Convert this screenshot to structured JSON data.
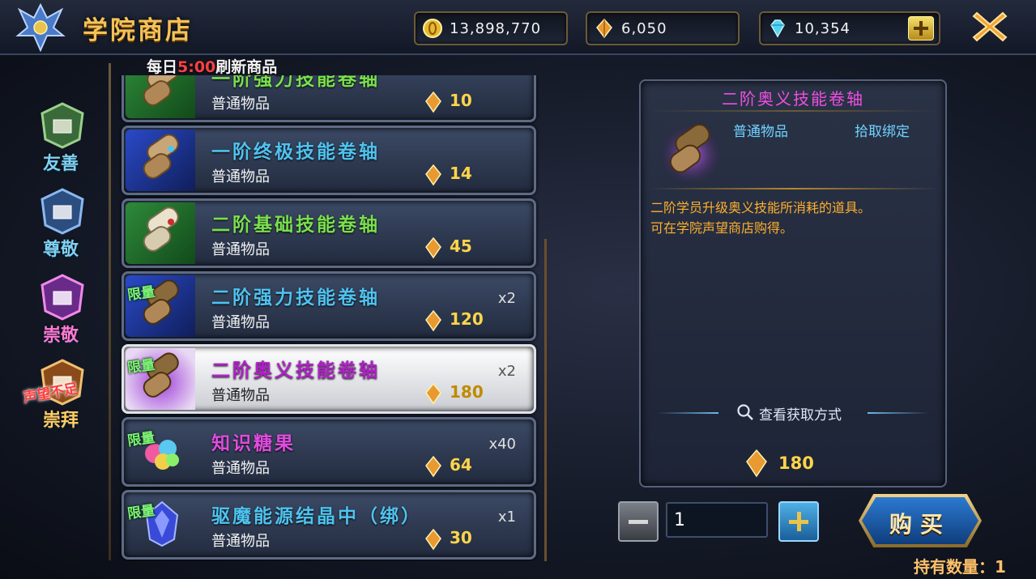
{
  "header": {
    "title": "学院商店",
    "currencies": [
      {
        "icon": "gold-coin-icon",
        "value": "13,898,770"
      },
      {
        "icon": "reputation-crystal-icon",
        "value": "6,050"
      },
      {
        "icon": "diamond-gem-icon",
        "value": "10,354"
      }
    ]
  },
  "refresh_note": {
    "prefix": "每日",
    "time": "5:00",
    "suffix": "刷新商品"
  },
  "categories": [
    {
      "label": "友善",
      "state": "normal"
    },
    {
      "label": "尊敬",
      "state": "normal"
    },
    {
      "label": "崇敬",
      "state": "active"
    },
    {
      "label": "崇拜",
      "state": "locked",
      "tag": "声望不足"
    }
  ],
  "items": [
    {
      "name": "一阶强力技能卷轴",
      "grade": "普通物品",
      "price": "10",
      "qty": "",
      "limited": false,
      "name_color": "#7ae04c",
      "bg": "green"
    },
    {
      "name": "一阶终极技能卷轴",
      "grade": "普通物品",
      "price": "14",
      "qty": "",
      "limited": false,
      "name_color": "#4fc3f0",
      "bg": "blue"
    },
    {
      "name": "二阶基础技能卷轴",
      "grade": "普通物品",
      "price": "45",
      "qty": "",
      "limited": false,
      "name_color": "#7ae04c",
      "bg": "green"
    },
    {
      "name": "二阶强力技能卷轴",
      "grade": "普通物品",
      "price": "120",
      "qty": "x2",
      "limited": true,
      "limit_label": "限量",
      "name_color": "#4fc3f0",
      "bg": "blue"
    },
    {
      "name": "二阶奥义技能卷轴",
      "grade": "普通物品",
      "price": "180",
      "qty": "x2",
      "limited": true,
      "limit_label": "限量",
      "name_color": "#b020c8",
      "bg": "purple",
      "selected": true
    },
    {
      "name": "知识糖果",
      "grade": "普通物品",
      "price": "64",
      "qty": "x40",
      "limited": true,
      "limit_label": "限量",
      "name_color": "#e04ce0",
      "bg": "none"
    },
    {
      "name": "驱魔能源结晶中（绑）",
      "grade": "普通物品",
      "price": "30",
      "qty": "x1",
      "limited": true,
      "limit_label": "限量",
      "name_color": "#4fc3f0",
      "bg": "none"
    }
  ],
  "detail": {
    "title": "二阶奥义技能卷轴",
    "grade": "普通物品",
    "bind": "拾取绑定",
    "desc_line1": "二阶学员升级奥义技能所消耗的道具。",
    "desc_line2": "可在学院声望商店购得。",
    "howto_label": "查看获取方式",
    "price": "180"
  },
  "purchase": {
    "quantity": "1",
    "buy_label": "购买",
    "owned_label": "持有数量：1"
  },
  "colors": {
    "gold": "#f3c25a",
    "price": "#ffd54a",
    "accent_blue": "#4fc3f0"
  }
}
